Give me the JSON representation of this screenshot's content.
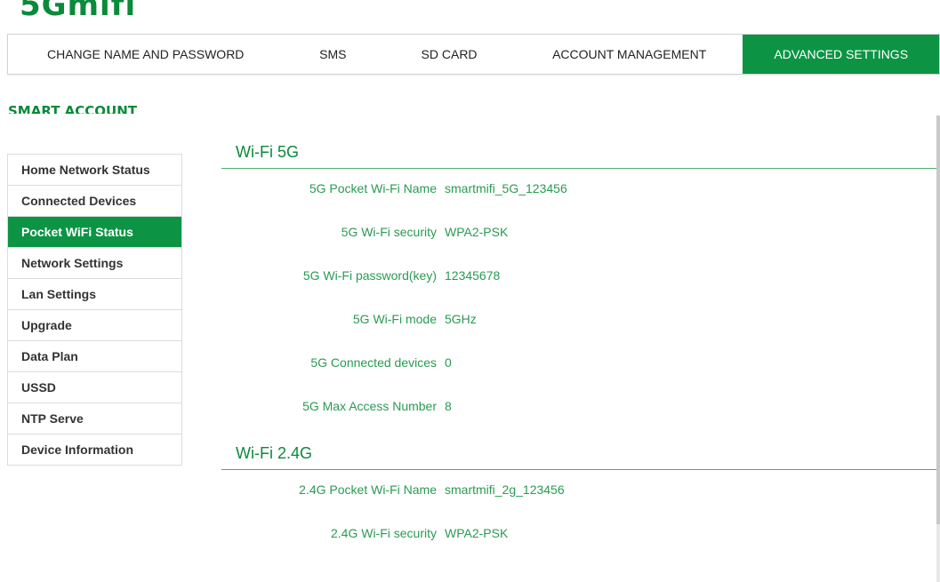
{
  "brand": {
    "logo_text": "5Gmifi"
  },
  "topnav": {
    "tabs": [
      {
        "label": "CHANGE NAME AND PASSWORD",
        "active": false
      },
      {
        "label": "SMS",
        "active": false
      },
      {
        "label": "SD CARD",
        "active": false
      },
      {
        "label": "ACCOUNT MANAGEMENT",
        "active": false
      },
      {
        "label": "ADVANCED SETTINGS",
        "active": true
      }
    ]
  },
  "section": {
    "title": "SMART ACCOUNT"
  },
  "sidebar": {
    "items": [
      {
        "label": "Home Network Status",
        "active": false
      },
      {
        "label": "Connected Devices",
        "active": false
      },
      {
        "label": "Pocket WiFi Status",
        "active": true
      },
      {
        "label": "Network Settings",
        "active": false
      },
      {
        "label": "Lan Settings",
        "active": false
      },
      {
        "label": "Upgrade",
        "active": false
      },
      {
        "label": "Data Plan",
        "active": false
      },
      {
        "label": "USSD",
        "active": false
      },
      {
        "label": "NTP Serve",
        "active": false
      },
      {
        "label": "Device Information",
        "active": false
      }
    ]
  },
  "wifi5g": {
    "title": "Wi-Fi 5G",
    "rows": [
      {
        "label": "5G Pocket Wi-Fi Name",
        "value": "smartmifi_5G_123456"
      },
      {
        "label": "5G Wi-Fi security",
        "value": "WPA2-PSK"
      },
      {
        "label": "5G Wi-Fi password(key)",
        "value": "12345678"
      },
      {
        "label": "5G Wi-Fi mode",
        "value": "5GHz"
      },
      {
        "label": "5G Connected devices",
        "value": "0"
      },
      {
        "label": "5G Max Access Number",
        "value": "8"
      }
    ]
  },
  "wifi24g": {
    "title": "Wi-Fi 2.4G",
    "rows": [
      {
        "label": "2.4G Pocket Wi-Fi Name",
        "value": "smartmifi_2g_123456"
      },
      {
        "label": "2.4G Wi-Fi security",
        "value": "WPA2-PSK"
      }
    ]
  },
  "colors": {
    "accent": "#0c9444",
    "text_green": "#2a9a52"
  }
}
